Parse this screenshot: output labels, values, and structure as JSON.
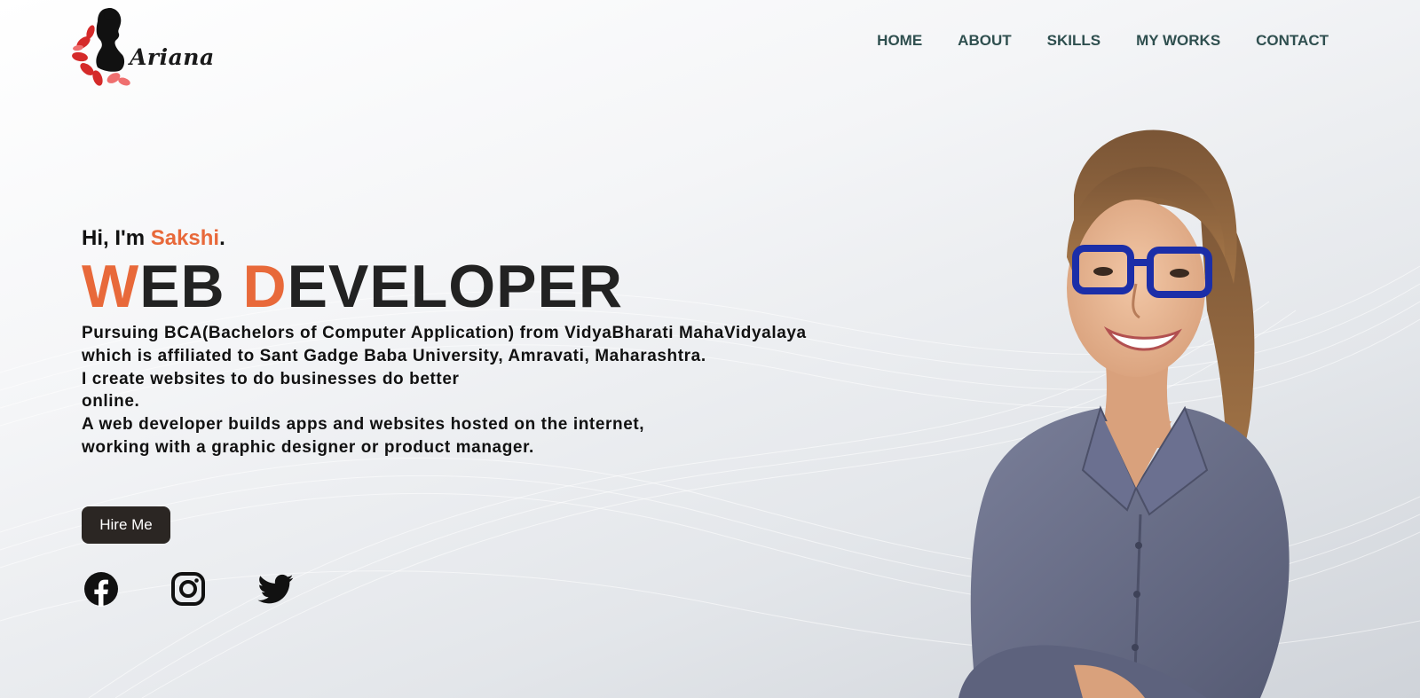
{
  "brand": {
    "logo_text": "Ariana",
    "logo_icon": "woman-silhouette-flower-logo"
  },
  "nav": {
    "items": [
      {
        "label": "HOME"
      },
      {
        "label": "ABOUT"
      },
      {
        "label": "SKILLS"
      },
      {
        "label": "MY WORKS"
      },
      {
        "label": "CONTACT"
      }
    ]
  },
  "hero": {
    "greeting_prefix": "Hi, I'm ",
    "name": "Sakshi",
    "greeting_suffix": ".",
    "title": {
      "first_initial": "W",
      "first_rest": "EB ",
      "second_initial": "D",
      "second_rest": "EVELOPER"
    },
    "description_lines": [
      "Pursuing BCA(Bachelors of Computer Application) from VidyaBharati MahaVidyalaya",
      "which is affiliated to Sant Gadge Baba University, Amravati, Maharashtra.",
      "I create websites to do businesses do better",
      "online.",
      "A web developer builds apps and websites hosted on the internet,",
      "working with a graphic designer or product manager."
    ],
    "hire_button": "Hire Me"
  },
  "social": [
    {
      "icon": "facebook-icon"
    },
    {
      "icon": "instagram-icon"
    },
    {
      "icon": "twitter-icon"
    }
  ],
  "colors": {
    "accent": "#e8693a",
    "nav_text": "#2f4f4f",
    "button_bg": "#2b2623",
    "title_text": "#222222"
  }
}
